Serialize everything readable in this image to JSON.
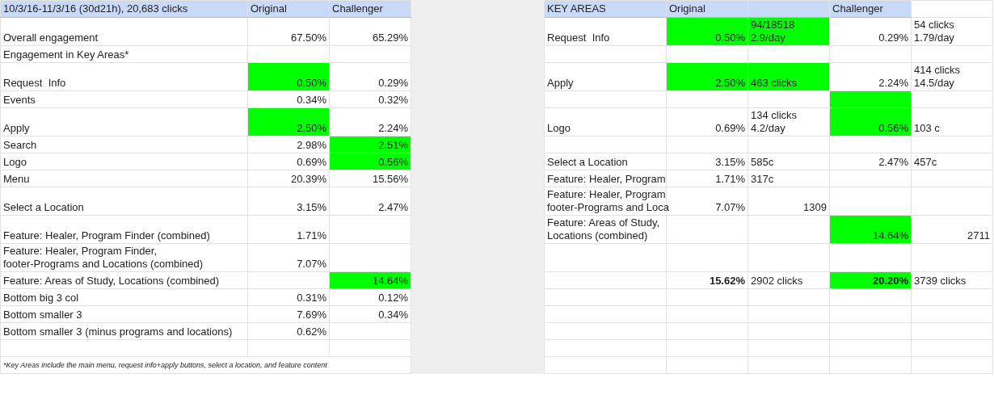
{
  "left_table": {
    "header": [
      "10/3/16-11/3/16 (30d21h), 20,683 clicks",
      "Original",
      "Challenger"
    ],
    "rows": [
      {
        "label": "Overall engagement",
        "original": {
          "value": "67.50%",
          "highlighted": false
        },
        "challenger": {
          "value": "65.29%",
          "highlighted": false
        }
      },
      {
        "label": "Engagement in Key Areas*"
      },
      {
        "label": "Request  Info",
        "original": {
          "value": "0.50%",
          "highlighted": true
        },
        "challenger": {
          "value": "0.29%",
          "highlighted": false
        }
      },
      {
        "label": "Events",
        "original": {
          "value": "0.34%",
          "highlighted": false
        },
        "challenger": {
          "value": "0.32%",
          "highlighted": false
        }
      },
      {
        "label": "Apply",
        "original": {
          "value": "2.50%",
          "highlighted": true
        },
        "challenger": {
          "value": "2.24%",
          "highlighted": false
        }
      },
      {
        "label": "Search",
        "original": {
          "value": "2.98%",
          "highlighted": false
        },
        "challenger": {
          "value": "2.51%",
          "highlighted": true
        }
      },
      {
        "label": "Logo",
        "original": {
          "value": "0.69%",
          "highlighted": false
        },
        "challenger": {
          "value": "0.56%",
          "highlighted": true
        }
      },
      {
        "label": "Menu",
        "original": {
          "value": "20.39%",
          "highlighted": false
        },
        "challenger": {
          "value": "15.56%",
          "highlighted": false
        }
      },
      {
        "label": "Select a Location",
        "original": {
          "value": "3.15%",
          "highlighted": false
        },
        "challenger": {
          "value": "2.47%",
          "highlighted": false
        }
      },
      {
        "label": "Feature: Healer, Program Finder (combined)",
        "original": {
          "value": "1.71%",
          "highlighted": false
        }
      },
      {
        "label": "Feature: Healer, Program Finder,\nfooter-Programs and Locations (combined)",
        "original": {
          "value": "7.07%",
          "highlighted": false
        }
      },
      {
        "label": "Feature: Areas of Study, Locations (combined)",
        "challenger": {
          "value": "14.64%",
          "highlighted": true
        }
      },
      {
        "label": "Bottom big 3 col",
        "original": {
          "value": "0.31%",
          "highlighted": false
        },
        "challenger": {
          "value": "0.12%",
          "highlighted": false
        }
      },
      {
        "label": "Bottom smaller 3",
        "original": {
          "value": "7.69%",
          "highlighted": false
        },
        "challenger": {
          "value": "0.34%",
          "highlighted": false
        }
      },
      {
        "label": "Bottom smaller 3 (minus programs and locations)",
        "original": {
          "value": "0.62%",
          "highlighted": false
        }
      }
    ],
    "footnote": "*Key Areas include the main menu, request info+apply buttons, select a location, and feature content"
  },
  "right_table": {
    "header": [
      "KEY AREAS",
      "Original",
      "Challenger"
    ],
    "rows": [
      {
        "kind": "item",
        "label": "Request  Info",
        "original": {
          "value": "0.50%",
          "highlighted": true
        },
        "original_clicks": {
          "text": "94/18518\n2.9/day",
          "kind": "text",
          "highlighted": true
        },
        "challenger": {
          "value": "0.29%",
          "highlighted": false
        },
        "challenger_clicks": {
          "text": "54 clicks\n1.79/day",
          "kind": "text"
        }
      },
      {
        "kind": "spacer"
      },
      {
        "kind": "item",
        "label": "Apply",
        "original": {
          "value": "2.50%",
          "highlighted": true
        },
        "original_clicks": {
          "text": "463 clicks",
          "kind": "text",
          "highlighted": true
        },
        "challenger": {
          "value": "2.24%",
          "highlighted": false
        },
        "challenger_clicks": {
          "text": "414 clicks\n14.5/day",
          "kind": "text"
        }
      },
      {
        "kind": "spacer",
        "challenger": {
          "highlighted": true
        }
      },
      {
        "kind": "item",
        "label": "Logo",
        "original": {
          "value": "0.69%",
          "highlighted": false
        },
        "original_clicks": {
          "text": "134 clicks\n4.2/day",
          "kind": "text",
          "highlighted": false
        },
        "challenger": {
          "value": "0.56%",
          "highlighted": true
        },
        "challenger_clicks": {
          "text": "103 c",
          "kind": "text"
        }
      },
      {
        "kind": "spacer"
      },
      {
        "kind": "item",
        "label": "Select a Location",
        "original": {
          "value": "3.15%",
          "highlighted": false
        },
        "original_clicks": {
          "text": "585c",
          "kind": "text",
          "highlighted": false
        },
        "challenger": {
          "value": "2.47%",
          "highlighted": false
        },
        "challenger_clicks": {
          "text": "457c",
          "kind": "text"
        }
      },
      {
        "kind": "item",
        "label": "Feature: Healer, Program",
        "original": {
          "value": "1.71%",
          "highlighted": false
        },
        "original_clicks": {
          "text": "317c",
          "kind": "text",
          "highlighted": false
        }
      },
      {
        "kind": "item",
        "label": "Feature: Healer, Program\nfooter-Programs and Loca",
        "original": {
          "value": "7.07%",
          "highlighted": false
        },
        "original_clicks": {
          "text": "1309",
          "kind": "number",
          "highlighted": false
        }
      },
      {
        "kind": "item",
        "label": "Feature: Areas of Study,\nLocations (combined)",
        "challenger": {
          "value": "14.64%",
          "highlighted": true
        },
        "challenger_clicks": {
          "text": "2711",
          "kind": "number"
        }
      },
      {
        "kind": "spacer"
      },
      {
        "kind": "total",
        "original": {
          "value": "15.62%",
          "highlighted": false
        },
        "original_clicks": {
          "text": "2902 clicks",
          "kind": "text",
          "highlighted": false
        },
        "challenger": {
          "value": "20.20%",
          "highlighted": true
        },
        "challenger_clicks": {
          "text": "3739 clicks",
          "kind": "text"
        }
      }
    ]
  }
}
